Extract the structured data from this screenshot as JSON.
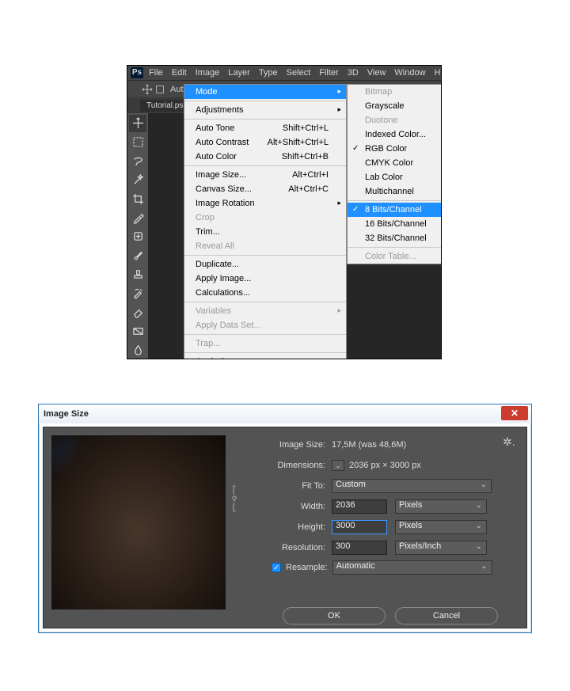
{
  "ps": {
    "logo": "Ps",
    "menubar": [
      "File",
      "Edit",
      "Image",
      "Layer",
      "Type",
      "Select",
      "Filter",
      "3D",
      "View",
      "Window",
      "Help"
    ],
    "toolOptions": {
      "autoSelect": "Auto"
    },
    "tab": "Tutorial.ps",
    "imageMenu": {
      "mode": {
        "label": "Mode"
      },
      "adjustments": {
        "label": "Adjustments"
      },
      "autoTone": {
        "label": "Auto Tone",
        "shortcut": "Shift+Ctrl+L"
      },
      "autoContrast": {
        "label": "Auto Contrast",
        "shortcut": "Alt+Shift+Ctrl+L"
      },
      "autoColor": {
        "label": "Auto Color",
        "shortcut": "Shift+Ctrl+B"
      },
      "imageSize": {
        "label": "Image Size...",
        "shortcut": "Alt+Ctrl+I"
      },
      "canvasSize": {
        "label": "Canvas Size...",
        "shortcut": "Alt+Ctrl+C"
      },
      "rotation": {
        "label": "Image Rotation"
      },
      "crop": {
        "label": "Crop"
      },
      "trim": {
        "label": "Trim..."
      },
      "revealAll": {
        "label": "Reveal All"
      },
      "duplicate": {
        "label": "Duplicate..."
      },
      "applyImage": {
        "label": "Apply Image..."
      },
      "calculations": {
        "label": "Calculations..."
      },
      "variables": {
        "label": "Variables"
      },
      "applyDataSet": {
        "label": "Apply Data Set..."
      },
      "trap": {
        "label": "Trap..."
      },
      "analysis": {
        "label": "Analysis"
      }
    },
    "modeMenu": {
      "bitmap": "Bitmap",
      "grayscale": "Grayscale",
      "duotone": "Duotone",
      "indexed": "Indexed Color...",
      "rgb": "RGB Color",
      "cmyk": "CMYK Color",
      "lab": "Lab Color",
      "multichannel": "Multichannel",
      "bits8": "8 Bits/Channel",
      "bits16": "16 Bits/Channel",
      "bits32": "32 Bits/Channel",
      "colorTable": "Color Table..."
    }
  },
  "dlg": {
    "title": "Image Size",
    "imageSizeLabel": "Image Size:",
    "imageSizeValue": "17,5M (was 48,6M)",
    "dimensionsLabel": "Dimensions:",
    "dimensionsValue": "2036 px  ×  3000 px",
    "fitToLabel": "Fit To:",
    "fitToValue": "Custom",
    "widthLabel": "Width:",
    "widthValue": "2036",
    "widthUnit": "Pixels",
    "heightLabel": "Height:",
    "heightValue": "3000",
    "heightUnit": "Pixels",
    "resolutionLabel": "Resolution:",
    "resolutionValue": "300",
    "resolutionUnit": "Pixels/Inch",
    "resampleLabel": "Resample:",
    "resampleValue": "Automatic",
    "ok": "OK",
    "cancel": "Cancel"
  }
}
